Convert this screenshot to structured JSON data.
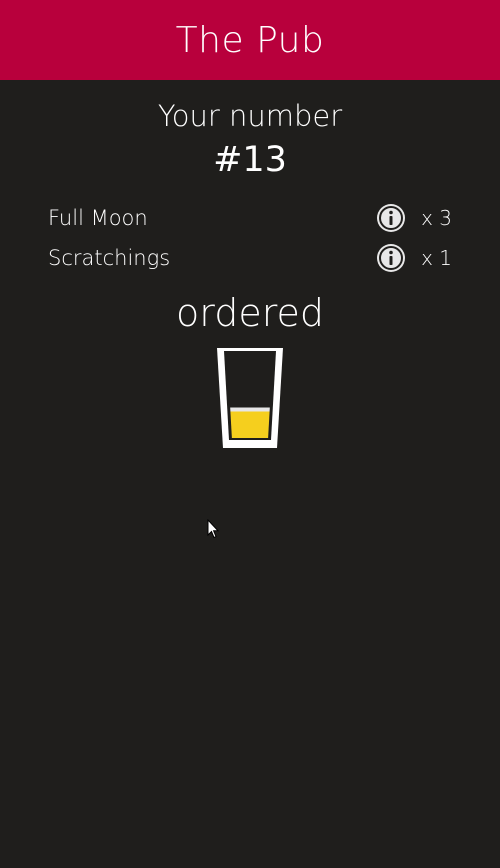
{
  "header": {
    "title": "The Pub",
    "color": "#b8003c"
  },
  "order": {
    "number_label": "Your number",
    "number": "#13",
    "status": "ordered",
    "fill_level": 0.35,
    "beer_color": "#f5cf1e",
    "items": [
      {
        "name": "Full Moon",
        "qty": "x 3",
        "icon": "info-icon"
      },
      {
        "name": "Scratchings",
        "qty": "x 1",
        "icon": "info-icon"
      }
    ]
  },
  "theme": {
    "background": "#1f1e1c",
    "text": "#ffffff"
  }
}
